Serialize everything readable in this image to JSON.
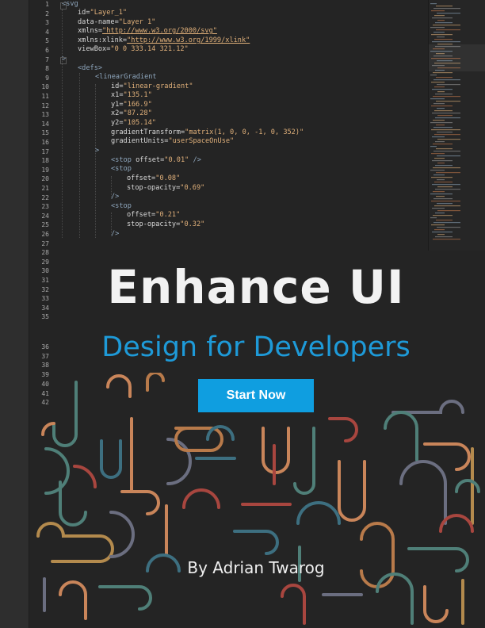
{
  "editor": {
    "line_numbers": [
      "1",
      "2",
      "3",
      "4",
      "5",
      "6",
      "7",
      "8",
      "9",
      "10",
      "11",
      "12",
      "13",
      "14",
      "15",
      "16",
      "17",
      "18",
      "19",
      "20",
      "21",
      "22",
      "23",
      "24",
      "25",
      "26",
      "27",
      "28",
      "29",
      "30",
      "31",
      "32",
      "33",
      "34",
      "35",
      "36",
      "37",
      "38",
      "39",
      "40",
      "41",
      "42"
    ],
    "code": {
      "l1": "<svg",
      "l2_attr": "id=",
      "l2_val": "\"Layer_1\"",
      "l3_attr": "data-name=",
      "l3_val": "\"Layer 1\"",
      "l4_attr": "xmlns=",
      "l4_val": "\"http://www.w3.org/2000/svg\"",
      "l5_attr": "xmlns:xlink=",
      "l5_val": "\"http://www.w3.org/1999/xlink\"",
      "l6_attr": "viewBox=",
      "l6_val": "\"0 0 333.14 321.12\"",
      "l7": ">",
      "l8": "<defs>",
      "l9": "<linearGradient",
      "l10_attr": "id=",
      "l10_val": "\"linear-gradient\"",
      "l11_attr": "x1=",
      "l11_val": "\"135.1\"",
      "l12_attr": "y1=",
      "l12_val": "\"166.9\"",
      "l13_attr": "x2=",
      "l13_val": "\"87.28\"",
      "l14_attr": "y2=",
      "l14_val": "\"105.14\"",
      "l15_attr": "gradientTransform=",
      "l15_val": "\"matrix(1, 0, 0, -1, 0, 352)\"",
      "l16_attr": "gradientUnits=",
      "l16_val": "\"userSpaceOnUse\"",
      "l17": ">",
      "l18_tag": "<stop",
      "l18_attr": "offset=",
      "l18_val": "\"0.01\"",
      "l18_end": "/>",
      "l19": "<stop",
      "l20_attr": "offset=",
      "l20_val": "\"0.08\"",
      "l21_attr": "stop-opacity=",
      "l21_val": "\"0.69\"",
      "l22": "/>",
      "l23": "<stop",
      "l24_attr": "offset=",
      "l24_val": "\"0.21\"",
      "l25_attr": "stop-opacity=",
      "l25_val": "\"0.32\"",
      "l26": "/>"
    }
  },
  "hero": {
    "title": "Enhance UI",
    "subtitle": "Design for Developers",
    "cta_label": "Start Now",
    "author": "By Adrian Twarog"
  },
  "colors": {
    "background": "#242424",
    "accent": "#1e9ad8",
    "button": "#0f9ee0",
    "pattern": [
      "#c9855a",
      "#b87a4a",
      "#4f7f78",
      "#3d6f80",
      "#a8463f",
      "#b38a4d",
      "#6b6e80"
    ]
  }
}
